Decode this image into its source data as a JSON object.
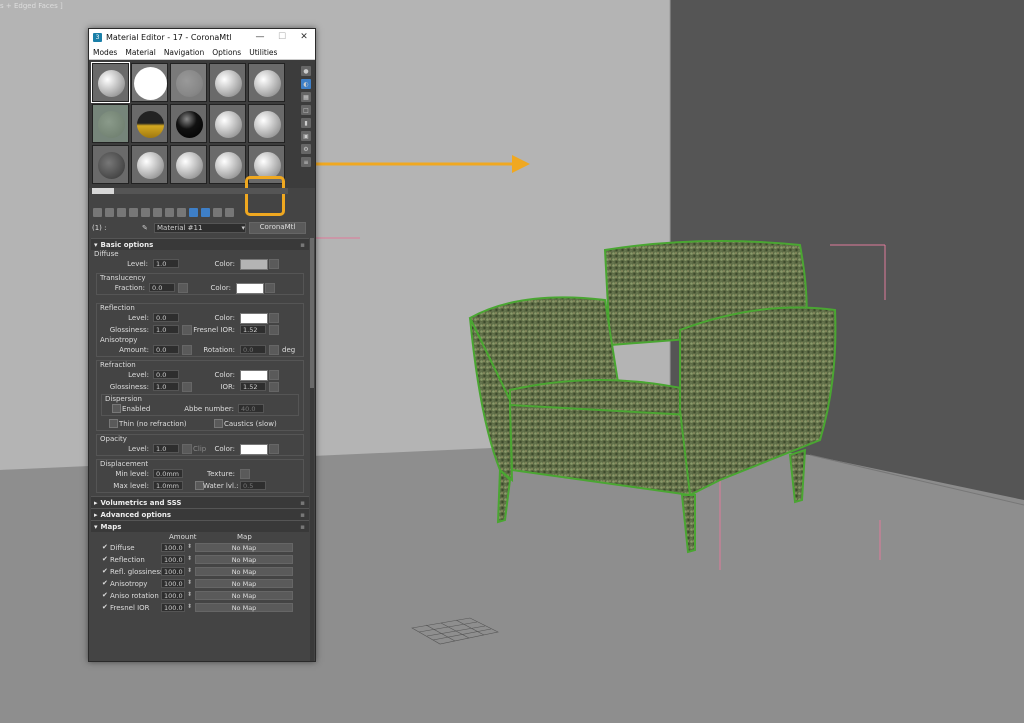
{
  "viewport": {
    "label": "s + Edged Faces ]"
  },
  "window": {
    "title": "Material Editor - 17 - CoronaMtl",
    "minimize": "—",
    "maximize": "☐",
    "close": "✕"
  },
  "menu": [
    "Modes",
    "Material",
    "Navigation",
    "Options",
    "Utilities"
  ],
  "name_row": {
    "slot": "(1) :",
    "material_name": "Material #11",
    "dropdown": "▾",
    "material_type": "CoronaMtl"
  },
  "rollouts": {
    "basic": "Basic options",
    "volumetrics": "Volumetrics and SSS",
    "advanced": "Advanced options",
    "maps": "Maps"
  },
  "diffuse": {
    "title": "Diffuse",
    "level_label": "Level:",
    "level": "1.0",
    "color_label": "Color:",
    "color_value": "#b4b4b4",
    "translucency": "Translucency",
    "fraction_label": "Fraction:",
    "fraction": "0.0",
    "tcolor_label": "Color:"
  },
  "reflection": {
    "title": "Reflection",
    "level_label": "Level:",
    "level": "0.0",
    "color_label": "Color:",
    "gloss_label": "Glossiness:",
    "gloss": "1.0",
    "ior_label": "Fresnel IOR:",
    "ior": "1.52",
    "aniso": "Anisotropy",
    "amount_label": "Amount:",
    "amount": "0.0",
    "rotation_label": "Rotation:",
    "rotation": "0.0",
    "deg": "deg"
  },
  "refraction": {
    "title": "Refraction",
    "level_label": "Level:",
    "level": "0.0",
    "color_label": "Color:",
    "gloss_label": "Glossiness:",
    "gloss": "1.0",
    "ior_label": "IOR:",
    "ior": "1.52",
    "dispersion": "Dispersion",
    "enabled": "Enabled",
    "abbe_label": "Abbe number:",
    "abbe": "40.0",
    "thin": "Thin (no refraction)",
    "caustics": "Caustics (slow)"
  },
  "opacity": {
    "title": "Opacity",
    "level_label": "Level:",
    "level": "1.0",
    "clip": "Clip",
    "color_label": "Color:"
  },
  "displacement": {
    "title": "Displacement",
    "min_label": "Min level:",
    "min": "0.0mm",
    "texture_label": "Texture:",
    "max_label": "Max level:",
    "max": "1.0mm",
    "water_label": "Water lvl.:",
    "water": "0.5"
  },
  "maps": {
    "amount_header": "Amount",
    "map_header": "Map",
    "rows": [
      {
        "name": "Diffuse",
        "amount": "100.0",
        "map": "No Map"
      },
      {
        "name": "Reflection",
        "amount": "100.0",
        "map": "No Map"
      },
      {
        "name": "Refl. glossiness",
        "amount": "100.0",
        "map": "No Map"
      },
      {
        "name": "Anisotropy",
        "amount": "100.0",
        "map": "No Map"
      },
      {
        "name": "Aniso rotation",
        "amount": "100.0",
        "map": "No Map"
      },
      {
        "name": "Fresnel IOR",
        "amount": "100.0",
        "map": "No Map"
      }
    ]
  },
  "colors": {
    "highlight": "#f0a820",
    "wire": "#4aa632",
    "accent": "#3e7fc7"
  }
}
